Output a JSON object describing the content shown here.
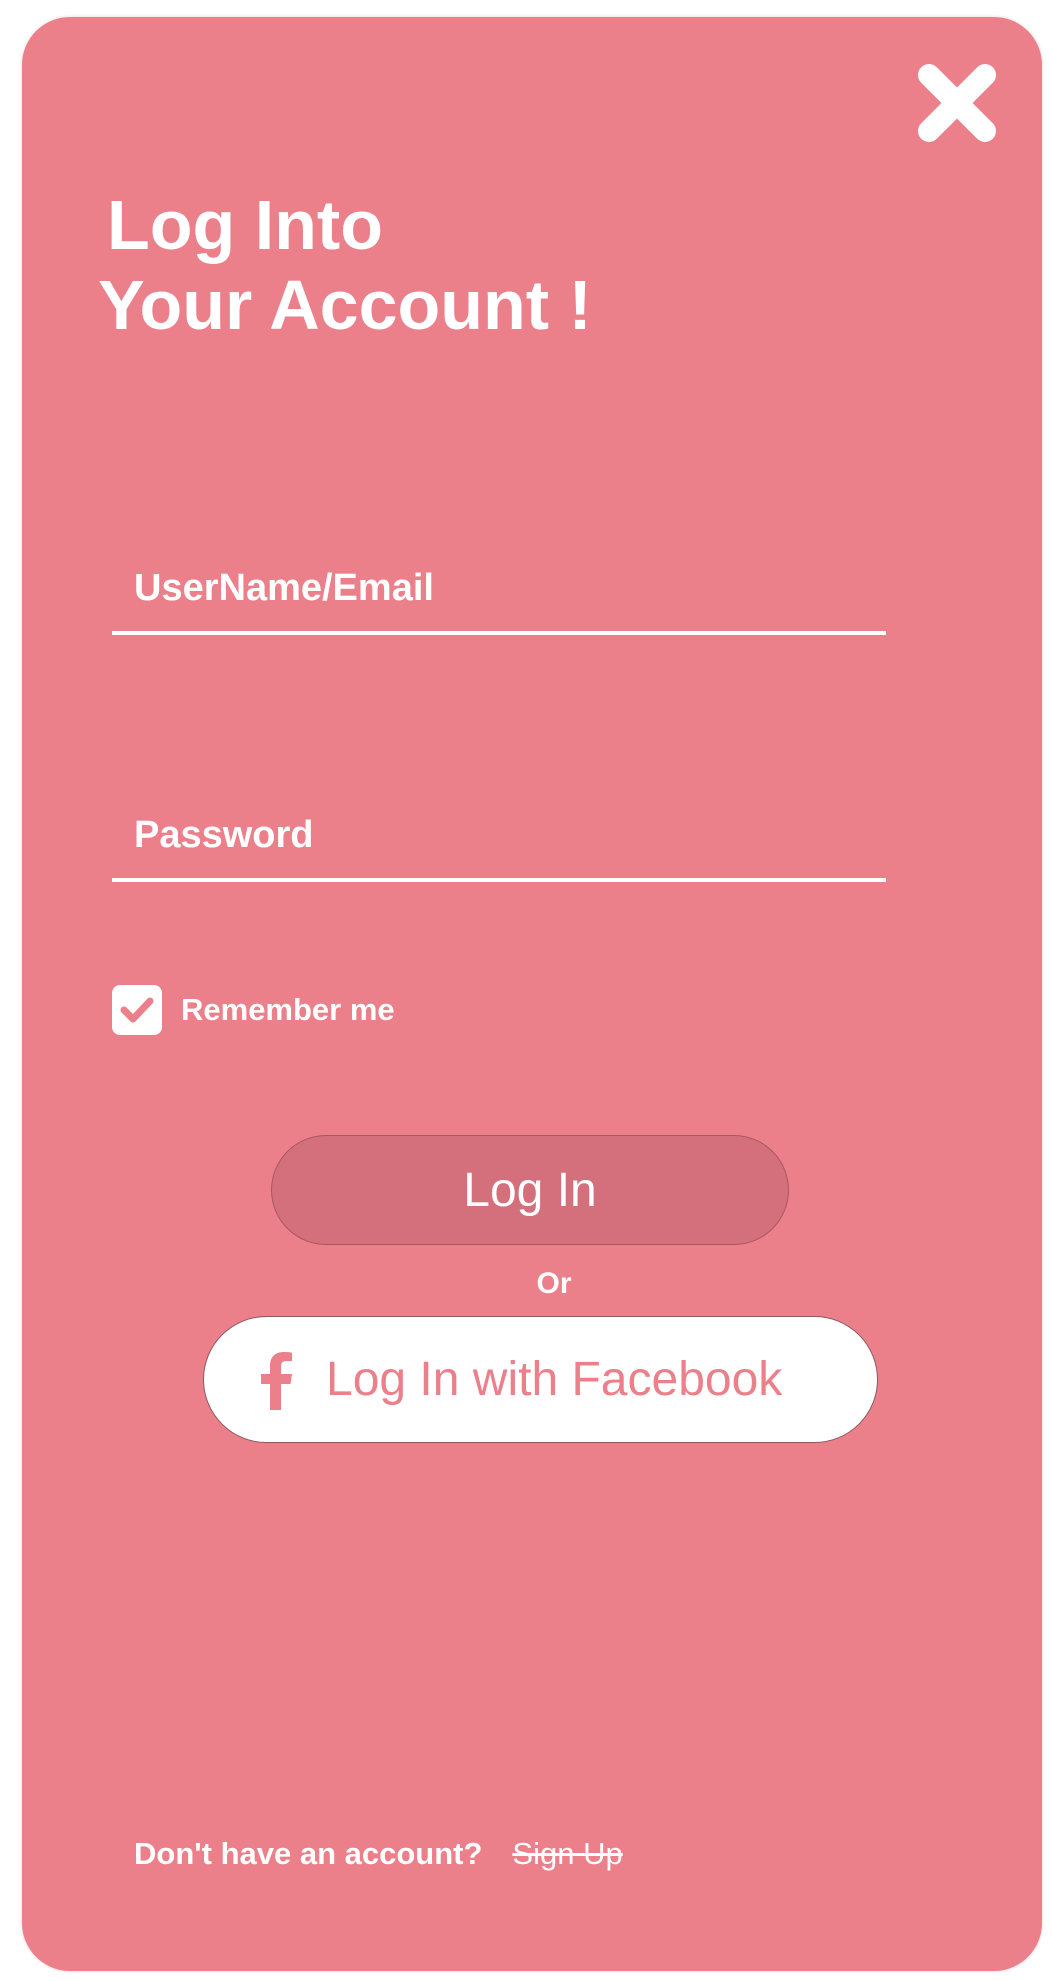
{
  "dialog": {
    "title_line1": "Log Into",
    "title_line2": "Your Account !",
    "close_icon": "close-icon"
  },
  "form": {
    "username_placeholder": "UserName/Email",
    "username_value": "",
    "password_placeholder": "Password",
    "password_value": "",
    "remember_label": "Remember me",
    "remember_checked": true,
    "login_label": "Log In",
    "or_label": "Or",
    "facebook_label": "Log In with Facebook",
    "facebook_icon": "facebook-icon"
  },
  "footer": {
    "prompt": "Don't have an account?",
    "signup_label": "Sign Up"
  },
  "colors": {
    "background": "#eb808b",
    "login_button": "#d4707c",
    "text": "#ffffff",
    "facebook_text": "#eb808b"
  }
}
